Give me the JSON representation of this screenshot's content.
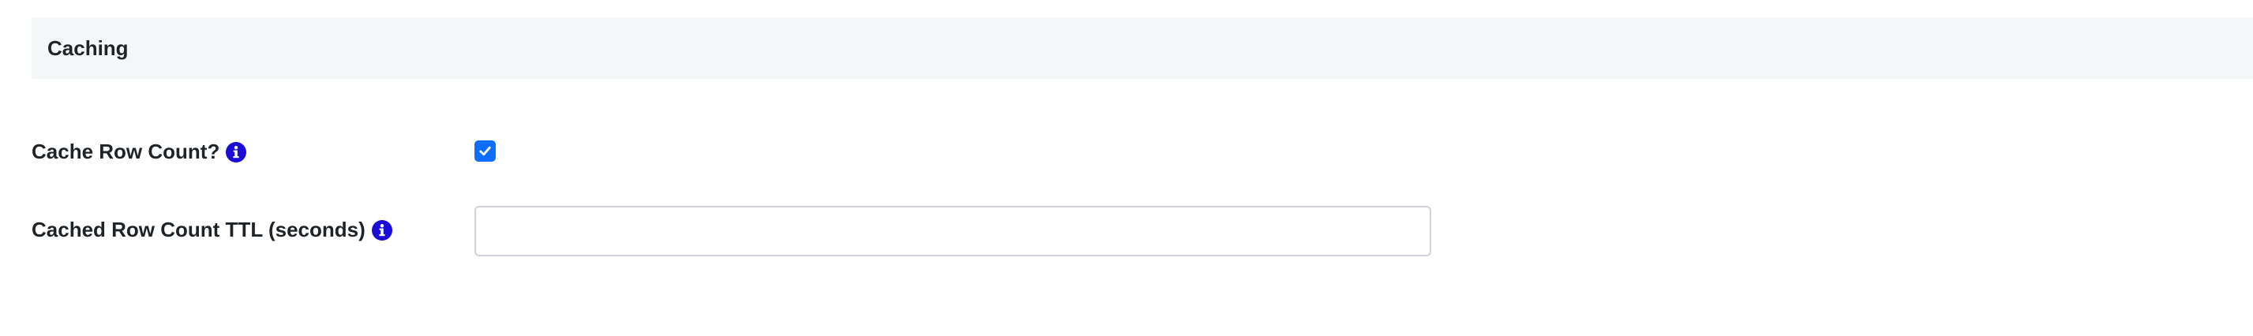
{
  "section": {
    "title": "Caching"
  },
  "fields": {
    "cache_row_count": {
      "label": "Cache Row Count?",
      "info_icon": "info-icon",
      "checked": true
    },
    "cached_row_count_ttl": {
      "label": "Cached Row Count TTL (seconds)",
      "info_icon": "info-icon",
      "value": "",
      "placeholder": ""
    }
  },
  "colors": {
    "accent": "#0d6efd",
    "info_icon": "#1a0dd6",
    "header_bg": "#f4f7f7",
    "input_border": "#ced4da"
  }
}
